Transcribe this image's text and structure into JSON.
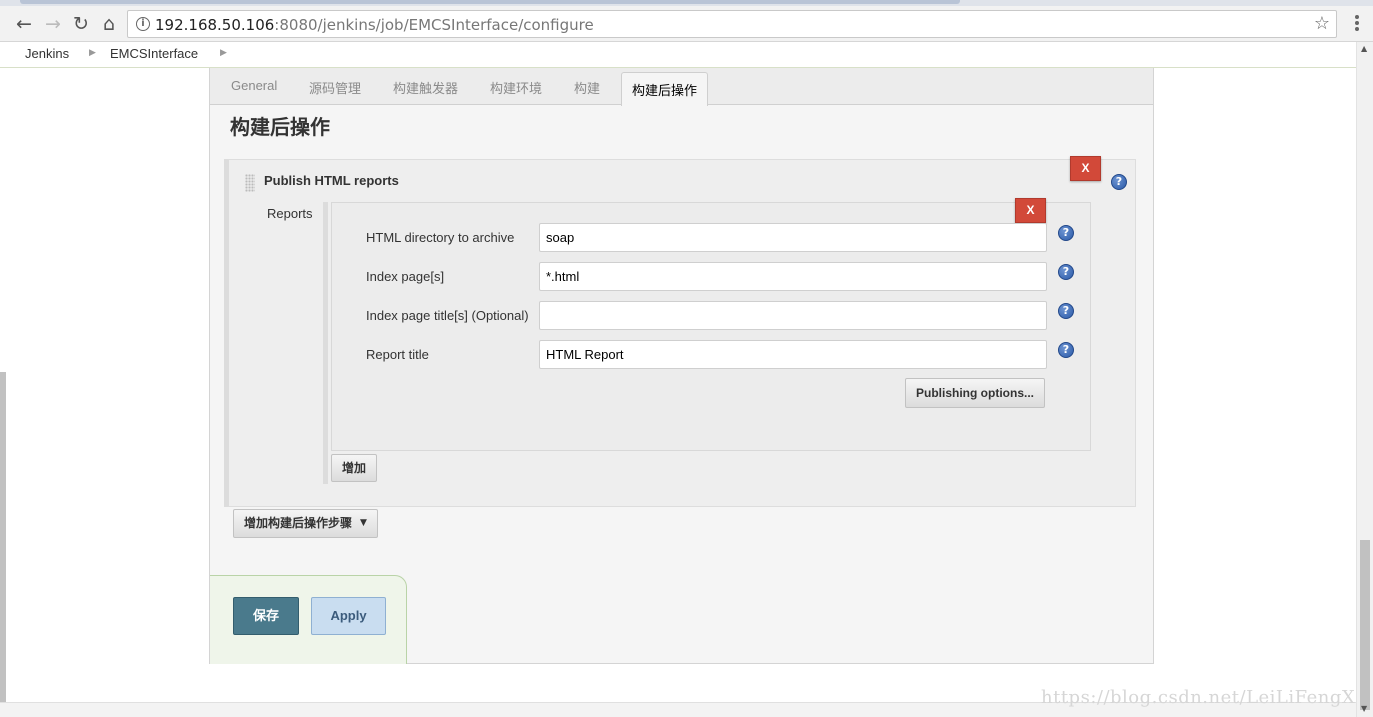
{
  "browser": {
    "url_host": "192.168.50.106",
    "url_rest": ":8080/jenkins/job/EMCSInterface/configure"
  },
  "breadcrumb": [
    "Jenkins",
    "EMCSInterface"
  ],
  "tabs": [
    "General",
    "源码管理",
    "构建触发器",
    "构建环境",
    "构建",
    "构建后操作"
  ],
  "active_tab": "构建后操作",
  "section_title": "构建后操作",
  "publisher": {
    "title": "Publish HTML reports",
    "delete_label": "X",
    "reports_label": "Reports",
    "report": {
      "delete_label": "X",
      "fields": [
        {
          "label": "HTML directory to archive",
          "value": "soap"
        },
        {
          "label": "Index page[s]",
          "value": "*.html"
        },
        {
          "label": "Index page title[s] (Optional)",
          "value": ""
        },
        {
          "label": "Report title",
          "value": "HTML Report"
        }
      ],
      "publishing_options_label": "Publishing options..."
    },
    "add_label": "增加"
  },
  "add_post_build_step_label": "增加构建后操作步骤",
  "save_label": "保存",
  "apply_label": "Apply",
  "watermark": "https://blog.csdn.net/LeiLiFengX",
  "help_glyph": "?",
  "colors": {
    "delete_red": "#d24939",
    "save_blue": "#4a7a8c",
    "apply_blue": "#c9ddf0",
    "help_blue": "#2b5aa8"
  }
}
